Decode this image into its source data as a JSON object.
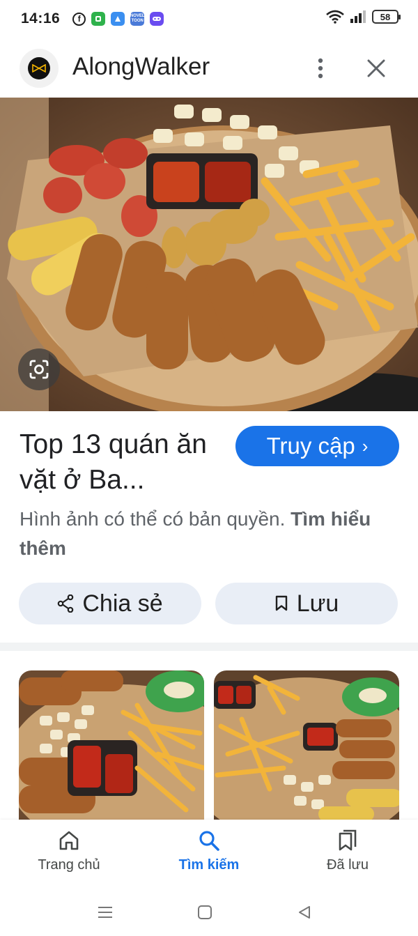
{
  "status_bar": {
    "time": "14:16",
    "battery": "58",
    "app_icons": [
      "facebook-icon",
      "green-app-icon",
      "blue-app-icon",
      "novel-toon-icon",
      "game-controller-icon"
    ],
    "novel_label_1": "NOVEL",
    "novel_label_2": "TOON"
  },
  "header": {
    "site_name": "AlongWalker"
  },
  "result": {
    "title": "Top 13 quán ăn vặt ở Ba...",
    "visit_label": "Truy cập",
    "copyright_text": "Hình ảnh có thể có bản quyền.",
    "learn_more": "Tìm hiểu thêm"
  },
  "actions": {
    "share_label": "Chia sẻ",
    "save_label": "Lưu"
  },
  "bottom_nav": {
    "items": [
      {
        "label": "Trang chủ",
        "icon": "home-icon"
      },
      {
        "label": "Tìm kiếm",
        "icon": "search-icon",
        "active": true
      },
      {
        "label": "Đã lưu",
        "icon": "saved-icon"
      }
    ]
  },
  "colors": {
    "accent": "#1a73e8",
    "pill_bg": "#e9eef6",
    "text_secondary": "#5f6368"
  }
}
